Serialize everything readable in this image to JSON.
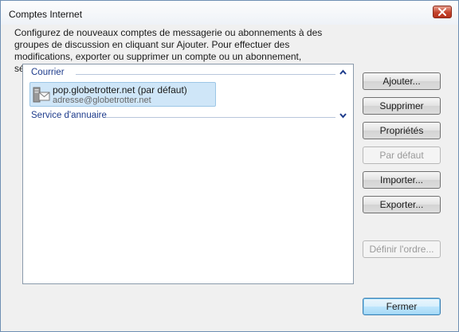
{
  "window": {
    "title": "Comptes Internet"
  },
  "intro_text": "Configurez de nouveaux comptes de messagerie ou abonnements à des groupes de discussion en cliquant sur Ajouter. Pour effectuer des modifications, exporter ou supprimer un compte ou un abonnement, sélectionnez-le d'abord.",
  "list": {
    "groups": [
      {
        "label": "Courrier",
        "state": "expanded",
        "chevron_icon": "chevron-up-icon"
      },
      {
        "label": "Service d'annuaire",
        "state": "collapsed",
        "chevron_icon": "chevron-down-icon"
      }
    ],
    "accounts": [
      {
        "name": "pop.globetrotter.net (par défaut)",
        "email": "adresse@globetrotter.net",
        "icon": "mail-account-icon",
        "selected": true
      }
    ]
  },
  "buttons": {
    "add": "Ajouter...",
    "remove": "Supprimer",
    "properties": "Propriétés",
    "set_default": "Par défaut",
    "import": "Importer...",
    "export": "Exporter...",
    "set_order": "Définir l'ordre...",
    "close": "Fermer"
  },
  "colors": {
    "selection_bg": "#cfe6f8",
    "group_header_text": "#1e3c8c",
    "close_button": "#c4422a"
  }
}
